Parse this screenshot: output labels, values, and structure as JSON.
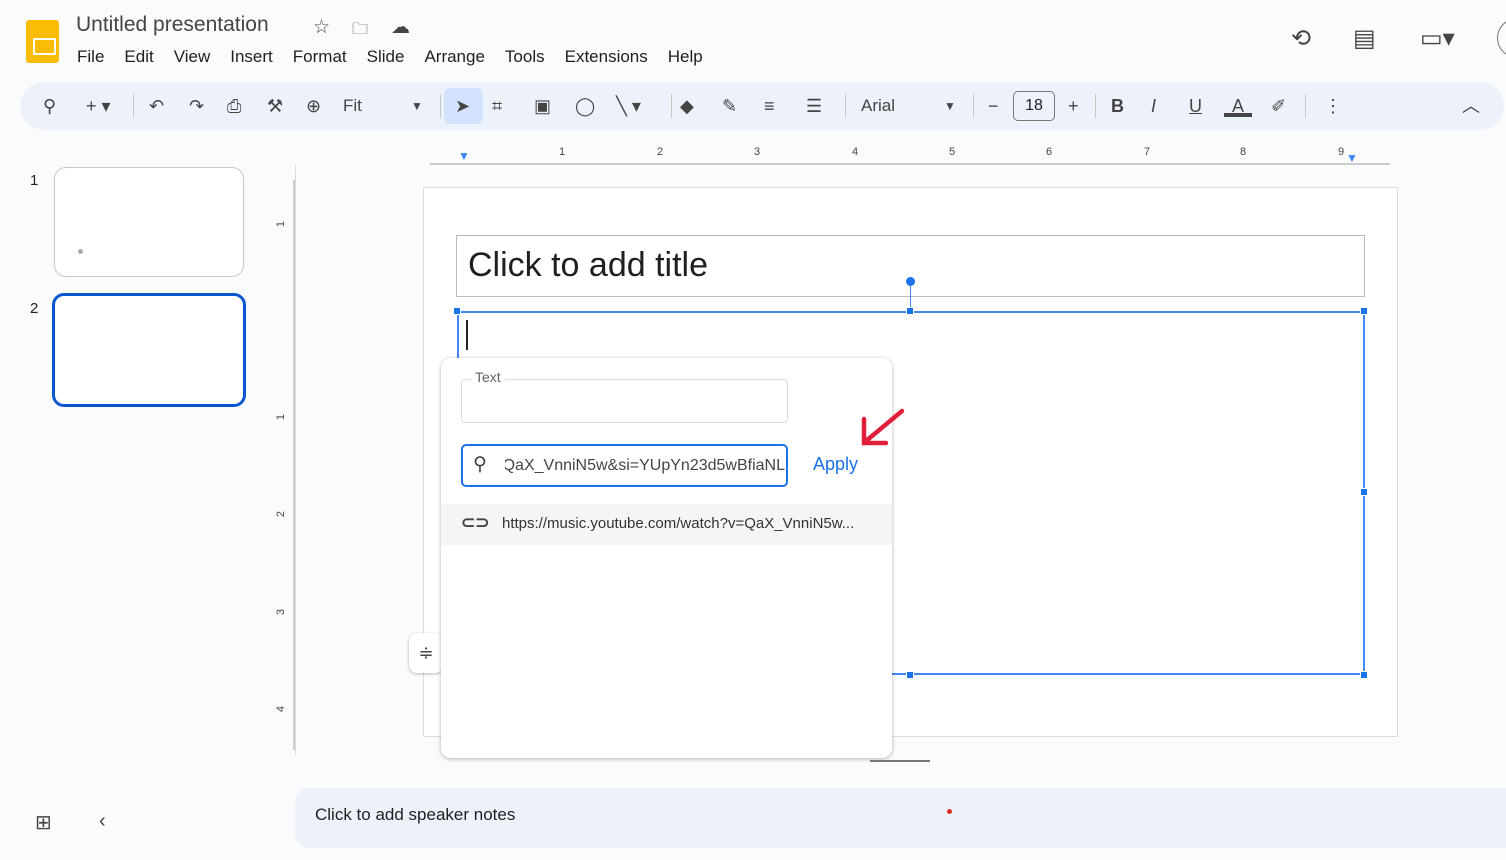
{
  "app": {
    "title": "Untitled presentation",
    "brand_color": "#fbbc04",
    "accent": "#1a73e8"
  },
  "menu": [
    "File",
    "Edit",
    "View",
    "Insert",
    "Format",
    "Slide",
    "Arrange",
    "Tools",
    "Extensions",
    "Help"
  ],
  "toolbar": {
    "zoom": "Fit",
    "font": "Arial",
    "font_size": "18"
  },
  "slides": [
    {
      "number": "1"
    },
    {
      "number": "2",
      "selected": true
    }
  ],
  "ruler": {
    "horizontal": [
      "1",
      "2",
      "3",
      "4",
      "5",
      "6",
      "7",
      "8",
      "9"
    ],
    "vertical": [
      "1",
      "1",
      "2",
      "3",
      "4"
    ]
  },
  "slide": {
    "title_placeholder": "Click to add title"
  },
  "link_popup": {
    "text_label": "Text",
    "text_value": "",
    "url_value": "https://music.youtube.com/watch?v=QaX_VnniN5w&si=YUpYn23d5wBfiaNL",
    "apply_label": "Apply",
    "suggestion": "https://music.youtube.com/watch?v=QaX_VnniN5w..."
  },
  "notes": {
    "placeholder": "Click to add speaker notes"
  }
}
